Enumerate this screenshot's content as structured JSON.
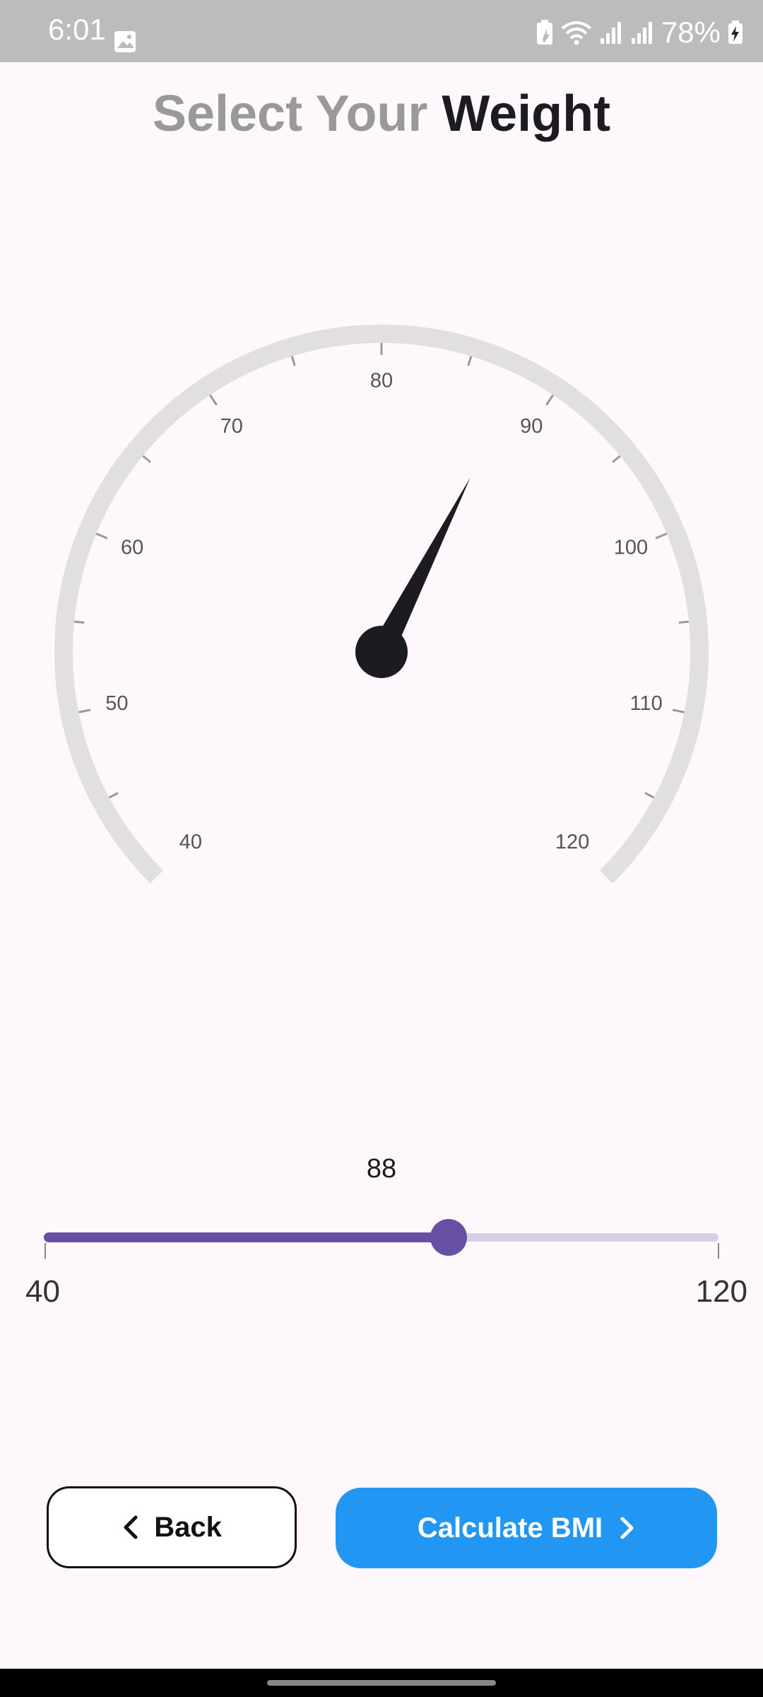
{
  "status_bar": {
    "time": "6:01",
    "battery_percent": "78%",
    "icons": [
      "image-icon",
      "battery-saver-icon",
      "wifi-icon",
      "signal-icon",
      "signal-icon",
      "battery-charging-icon"
    ]
  },
  "title": {
    "part1": "Select Your ",
    "part2": "Weight"
  },
  "gauge": {
    "min": 40,
    "max": 120,
    "major_ticks": [
      40,
      50,
      60,
      70,
      80,
      90,
      100,
      110,
      120
    ],
    "needle_value": 88,
    "arc_color": "#E1DFE1",
    "needle_color": "#1C1B1F"
  },
  "slider": {
    "value": 88,
    "value_label": "88",
    "min": 40,
    "max": 120,
    "min_label": "40",
    "max_label": "120",
    "active_color": "#6750A4",
    "inactive_color": "#D6CFE5"
  },
  "buttons": {
    "back_label": "Back",
    "calculate_label": "Calculate BMI",
    "calculate_color": "#2196F3"
  }
}
